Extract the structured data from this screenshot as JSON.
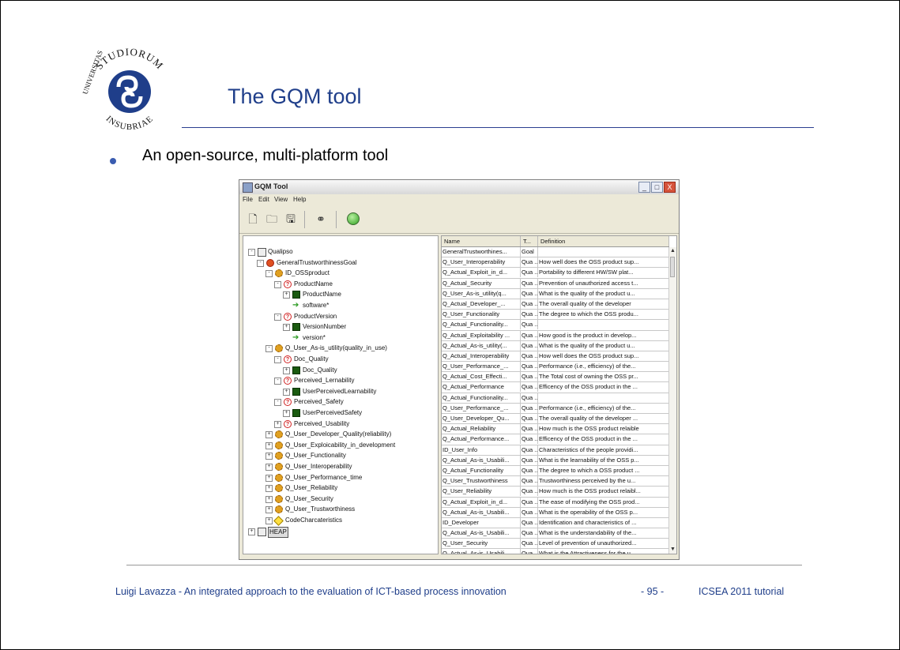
{
  "slide": {
    "title": "The GQM tool",
    "bullet": "An open-source, multi-platform tool",
    "logo": {
      "top_text": "STUDIORUM",
      "left_text": "UNIVERSITAS",
      "bottom_text": "INSUBRIAE"
    },
    "footer_left": "Luigi Lavazza - An integrated approach to the evaluation of ICT-based process innovation",
    "footer_page": "- 95 -",
    "footer_right": "ICSEA 2011 tutorial",
    "accent_color": "#1f3e8a"
  },
  "app": {
    "title": "GQM Tool",
    "window_buttons": {
      "minimize": "_",
      "maximize": "□",
      "close": "X"
    },
    "menu": [
      "File",
      "Edit",
      "View",
      "Help"
    ],
    "toolbar_icons": [
      "new-document-icon",
      "open-folder-icon",
      "save-disk-icon",
      "binoculars-icon",
      "go-green-circle-icon"
    ],
    "tree": [
      {
        "label": "Qualipso",
        "icon": "root-icon",
        "level": 0,
        "exp": "-"
      },
      {
        "label": "GeneralTrustworthinessGoal",
        "icon": "goal-icon",
        "level": 1,
        "exp": "-"
      },
      {
        "label": "ID_OSSproduct",
        "icon": "gear-icon",
        "level": 2,
        "exp": "-"
      },
      {
        "label": "ProductName",
        "icon": "question-icon",
        "level": 3,
        "exp": "-"
      },
      {
        "label": "ProductName",
        "icon": "metric-icon",
        "level": 4,
        "exp": "+"
      },
      {
        "label": "software*",
        "icon": "arrow-icon",
        "level": 4,
        "exp": ""
      },
      {
        "label": "ProductVersion",
        "icon": "question-icon",
        "level": 3,
        "exp": "-"
      },
      {
        "label": "VersionNumber",
        "icon": "metric-icon",
        "level": 4,
        "exp": "+"
      },
      {
        "label": "version*",
        "icon": "arrow-icon",
        "level": 4,
        "exp": ""
      },
      {
        "label": "Q_User_As-is_utility(quality_in_use)",
        "icon": "gear-icon",
        "level": 2,
        "exp": "-"
      },
      {
        "label": "Doc_Quality",
        "icon": "question-icon",
        "level": 3,
        "exp": "-"
      },
      {
        "label": "Doc_Quality",
        "icon": "metric-icon",
        "level": 4,
        "exp": "+"
      },
      {
        "label": "Perceived_Lernability",
        "icon": "question-icon",
        "level": 3,
        "exp": "-"
      },
      {
        "label": "UserPerceivedLearnability",
        "icon": "metric-icon",
        "level": 4,
        "exp": "+"
      },
      {
        "label": "Perceived_Safety",
        "icon": "question-icon",
        "level": 3,
        "exp": "-"
      },
      {
        "label": "UserPerceivedSafety",
        "icon": "metric-icon",
        "level": 4,
        "exp": "+"
      },
      {
        "label": "Perceived_Usability",
        "icon": "question-icon",
        "level": 3,
        "exp": "+"
      },
      {
        "label": "Q_User_Developer_Quality(reliability)",
        "icon": "gear-icon",
        "level": 2,
        "exp": "+"
      },
      {
        "label": "Q_User_Exploicability_in_development",
        "icon": "gear-icon",
        "level": 2,
        "exp": "+"
      },
      {
        "label": "Q_User_Functionality",
        "icon": "gear-icon",
        "level": 2,
        "exp": "+"
      },
      {
        "label": "Q_User_Interoperability",
        "icon": "gear-icon",
        "level": 2,
        "exp": "+"
      },
      {
        "label": "Q_User_Performance_time",
        "icon": "gear-icon",
        "level": 2,
        "exp": "+"
      },
      {
        "label": "Q_User_Reliability",
        "icon": "gear-icon",
        "level": 2,
        "exp": "+"
      },
      {
        "label": "Q_User_Security",
        "icon": "gear-icon",
        "level": 2,
        "exp": "+"
      },
      {
        "label": "Q_User_Trustworthiness",
        "icon": "gear-icon",
        "level": 2,
        "exp": "+"
      },
      {
        "label": "CodeCharcateristics",
        "icon": "diamond-icon",
        "level": 2,
        "exp": "+"
      },
      {
        "label": "HEAP",
        "icon": "heap-icon",
        "level": 0,
        "exp": "+"
      }
    ],
    "table": {
      "columns": [
        "Name",
        "T...",
        "Definition"
      ],
      "rows": [
        [
          "GeneralTrustworthines...",
          "Goal",
          ""
        ],
        [
          "Q_User_Interoperability",
          "Qua ..",
          "How well does the OSS product sup..."
        ],
        [
          "Q_Actual_Exploit_in_d...",
          "Qua ..",
          "Portability to different HW/SW plat..."
        ],
        [
          "Q_Actual_Security",
          "Qua ..",
          "Prevention of unauthorized access t..."
        ],
        [
          "Q_User_As-is_utility(q...",
          "Qua ..",
          "What is the quality of the product u..."
        ],
        [
          "Q_Actual_Developer_...",
          "Qua ..",
          "The overall quality of the developer"
        ],
        [
          "Q_User_Functionality",
          "Qua ..",
          "The degree to which the OSS produ..."
        ],
        [
          "Q_Actual_Functionality...",
          "Qua ..",
          ""
        ],
        [
          "Q_Actual_Exploitability ...",
          "Qua ..",
          "How good is the product in develop..."
        ],
        [
          "Q_Actual_As-is_utility(...",
          "Qua ..",
          "What is the quality of the product u..."
        ],
        [
          "Q_Actual_Interoperability",
          "Qua ..",
          "How well does the OSS product sup..."
        ],
        [
          "Q_User_Performance_...",
          "Qua ..",
          "Performance (i.e., efficiency) of the..."
        ],
        [
          "Q_Actual_Cost_Effecti...",
          "Qua ..",
          "The Total cost of owning the OSS pr..."
        ],
        [
          "Q_Actual_Performance",
          "Qua ..",
          "Efficency of the OSS product in the ..."
        ],
        [
          "Q_Actual_Functionality...",
          "Qua ..",
          ""
        ],
        [
          "Q_User_Performance_...",
          "Qua ..",
          "Performance (i.e., efficiency) of the..."
        ],
        [
          "Q_User_Developer_Qu...",
          "Qua ..",
          "The overall quality of the developer ..."
        ],
        [
          "Q_Actual_Reliability",
          "Qua ..",
          "How much is the OSS product relaible"
        ],
        [
          "Q_Actual_Performance...",
          "Qua ..",
          "Efficency of the OSS product in the ..."
        ],
        [
          "ID_User_Info",
          "Qua ..",
          "Characteristics of the people providi..."
        ],
        [
          "Q_Actual_As-is_Usabili...",
          "Qua ..",
          "What is the learnability of the OSS p..."
        ],
        [
          "Q_Actual_Functionality",
          "Qua ..",
          "The degree to which a OSS product ..."
        ],
        [
          "Q_User_Trustworthiness",
          "Qua ..",
          "Trustworthiness perceived by the u..."
        ],
        [
          "Q_User_Reliability",
          "Qua ..",
          "How much is the OSS product relaibl..."
        ],
        [
          "Q_Actual_Exploit_in_d...",
          "Qua ..",
          "The ease of modifying the OSS prod..."
        ],
        [
          "Q_Actual_As-is_Usabili...",
          "Qua ..",
          "What is the operability of the OSS p..."
        ],
        [
          "ID_Developer",
          "Qua ..",
          "Identification and characteristics of ..."
        ],
        [
          "Q_Actual_As-is_Usabili...",
          "Qua ..",
          "What is the understandability of the..."
        ],
        [
          "Q_User_Security",
          "Qua ..",
          "Level of prevention of unauthorized..."
        ],
        [
          "Q_Actual_As-is_Usabili...",
          "Qua ..",
          "What is the Attractiveness for the u..."
        ]
      ]
    }
  }
}
